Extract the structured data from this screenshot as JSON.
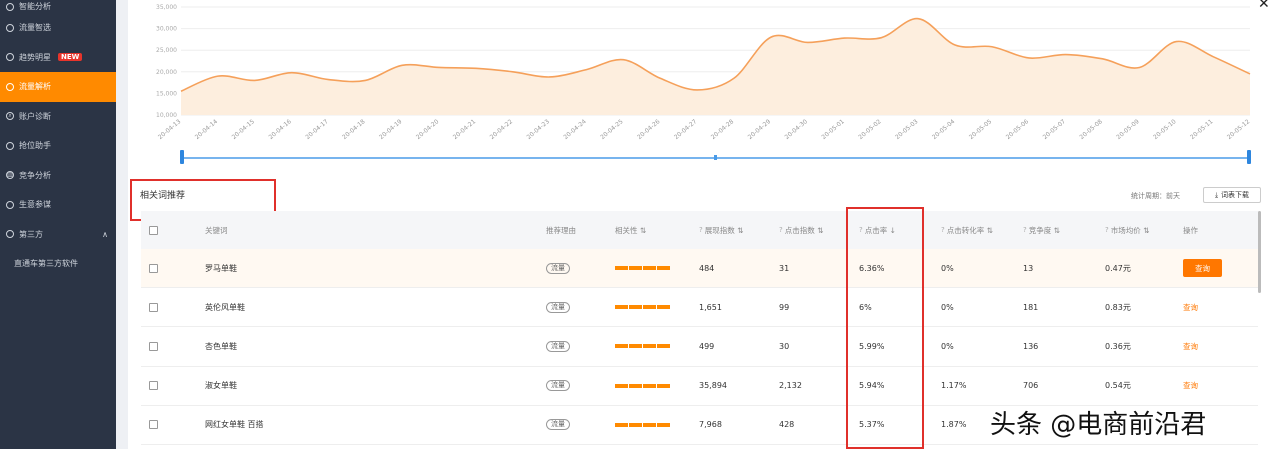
{
  "sidebar": {
    "items": [
      {
        "label": "智能分析",
        "icon": "circle-icon",
        "active": false
      },
      {
        "label": "流量智选",
        "icon": "circle-icon",
        "active": false
      },
      {
        "label": "趋势明星",
        "icon": "circle-icon",
        "active": false,
        "badge": "NEW"
      },
      {
        "label": "流量解析",
        "icon": "circle-icon",
        "active": true
      },
      {
        "label": "账户诊断",
        "icon": "search-icon",
        "active": false
      },
      {
        "label": "抢位助手",
        "icon": "circle-icon",
        "active": false
      },
      {
        "label": "竞争分析",
        "icon": "bar-chart-icon",
        "active": false
      },
      {
        "label": "生意参谋",
        "icon": "circle-icon",
        "active": false
      },
      {
        "label": "第三方",
        "icon": "circle-icon",
        "active": false,
        "expanded": true
      }
    ],
    "sub_items": [
      "直通车第三方软件"
    ]
  },
  "chart_data": {
    "type": "area",
    "x": [
      "20-04-13",
      "20-04-14",
      "20-04-15",
      "20-04-16",
      "20-04-17",
      "20-04-18",
      "20-04-19",
      "20-04-20",
      "20-04-21",
      "20-04-22",
      "20-04-23",
      "20-04-24",
      "20-04-25",
      "20-04-26",
      "20-04-27",
      "20-04-28",
      "20-04-29",
      "20-04-30",
      "20-05-01",
      "20-05-02",
      "20-05-03",
      "20-05-04",
      "20-05-05",
      "20-05-06",
      "20-05-07",
      "20-05-08",
      "20-05-09",
      "20-05-10",
      "20-05-11",
      "20-05-12"
    ],
    "values": [
      15500,
      19000,
      18000,
      19800,
      18200,
      18000,
      21500,
      21000,
      20800,
      20000,
      18800,
      20500,
      22800,
      18500,
      15800,
      18500,
      28000,
      26800,
      27800,
      27900,
      32300,
      26200,
      25800,
      23200,
      24000,
      23000,
      21000,
      27000,
      23500,
      19500
    ],
    "yticks": [
      "10,000",
      "15,000",
      "20,000",
      "25,000",
      "30,000",
      "35,000"
    ],
    "ylim": [
      10000,
      35000
    ],
    "color": "#f5a05a",
    "fill": "#fdeede",
    "grid": true
  },
  "section": {
    "title": "相关词推荐",
    "stat_period": "统计周期：前天",
    "download_label": "词表下载"
  },
  "table": {
    "headers": [
      "关键词",
      "推荐理由",
      "相关性",
      "展现指数",
      "点击指数",
      "点击率",
      "点击转化率",
      "竞争度",
      "市场均价",
      "操作"
    ],
    "rows": [
      {
        "keyword": "罗马单鞋",
        "reason": "流量",
        "impressions": "484",
        "clicks": "31",
        "ctr": "6.36%",
        "cvr": "0%",
        "competition": "13",
        "price": "0.47元",
        "action": "查询"
      },
      {
        "keyword": "英伦风单鞋",
        "reason": "流量",
        "impressions": "1,651",
        "clicks": "99",
        "ctr": "6%",
        "cvr": "0%",
        "competition": "181",
        "price": "0.83元",
        "action": "查询"
      },
      {
        "keyword": "杏色单鞋",
        "reason": "流量",
        "impressions": "499",
        "clicks": "30",
        "ctr": "5.99%",
        "cvr": "0%",
        "competition": "136",
        "price": "0.36元",
        "action": "查询"
      },
      {
        "keyword": "淑女单鞋",
        "reason": "流量",
        "impressions": "35,894",
        "clicks": "2,132",
        "ctr": "5.94%",
        "cvr": "1.17%",
        "competition": "706",
        "price": "0.54元",
        "action": "查询"
      },
      {
        "keyword": "网红女单鞋 百搭",
        "reason": "流量",
        "impressions": "7,968",
        "clicks": "428",
        "ctr": "5.37%",
        "cvr": "1.87%",
        "competition": "",
        "price": "",
        "action": ""
      }
    ]
  },
  "watermark": "头条 @电商前沿君"
}
